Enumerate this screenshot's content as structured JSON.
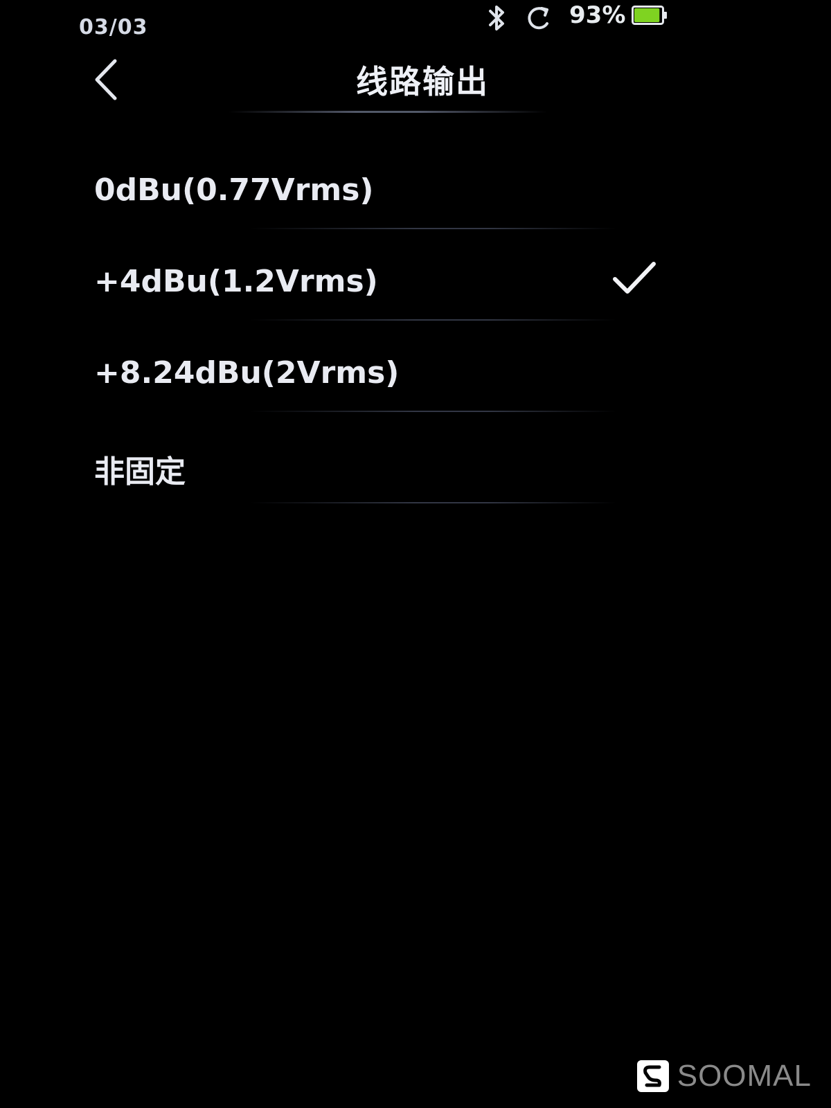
{
  "status_bar": {
    "date": "03/03",
    "battery_percent": "93%",
    "battery_level": 0.93,
    "battery_color": "#7fd321",
    "icons": [
      "bluetooth-icon",
      "sync-icon",
      "battery-icon"
    ]
  },
  "header": {
    "back_icon": "chevron-left-icon",
    "title": "线路输出"
  },
  "options": [
    {
      "label": "0dBu(0.77Vrms)",
      "selected": false
    },
    {
      "label": "+4dBu(1.2Vrms)",
      "selected": true
    },
    {
      "label": "+8.24dBu(2Vrms)",
      "selected": false
    },
    {
      "label": "非固定",
      "selected": false
    }
  ],
  "watermark": {
    "text": "SOOMAL"
  }
}
